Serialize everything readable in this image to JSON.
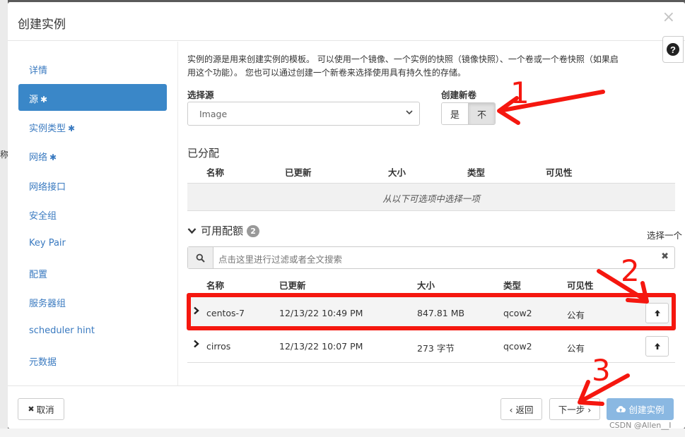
{
  "modal": {
    "title": "创建实例",
    "close_glyph": "×",
    "help_glyph": "?"
  },
  "backdrop": {
    "partial_char": "称"
  },
  "sidebar": {
    "items": [
      {
        "label": "详情",
        "required": false
      },
      {
        "label": "源",
        "required": true,
        "active": true
      },
      {
        "label": "实例类型",
        "required": true
      },
      {
        "label": "网络",
        "required": true
      },
      {
        "label": "网络接口",
        "required": false
      },
      {
        "label": "安全组",
        "required": false
      },
      {
        "label": "Key Pair",
        "required": false
      },
      {
        "label": "配置",
        "required": false
      },
      {
        "label": "服务器组",
        "required": false
      },
      {
        "label": "scheduler hint",
        "required": false
      },
      {
        "label": "元数据",
        "required": false
      }
    ],
    "required_marker": "✱"
  },
  "source": {
    "description_line1": "实例的源是用来创建实例的模板。 可以使用一个镜像、一个实例的快照（镜像快照）、一个卷或一个卷快照（如果启",
    "description_line2": "用这个功能）。 您也可以通过创建一个新卷来选择使用具有持久性的存储。",
    "select_source_label": "选择源",
    "select_source_value": "Image",
    "create_volume_label": "创建新卷",
    "create_volume_yes": "是",
    "create_volume_no": "不",
    "create_volume_selected": "不"
  },
  "allocated": {
    "title": "已分配",
    "columns": [
      "名称",
      "已更新",
      "大小",
      "类型",
      "可见性"
    ],
    "empty_text": "从以下可选项中选择一项"
  },
  "available": {
    "title": "可用配额",
    "count": "2",
    "pick_hint": "选择一个",
    "search_placeholder": "点击这里进行过滤或者全文搜索",
    "columns": [
      "名称",
      "已更新",
      "大小",
      "类型",
      "可见性"
    ],
    "rows": [
      {
        "name": "centos-7",
        "updated": "12/13/22 10:49 PM",
        "size": "847.81 MB",
        "type": "qcow2",
        "visibility": "公有"
      },
      {
        "name": "cirros",
        "updated": "12/13/22 10:07 PM",
        "size": "273 字节",
        "type": "qcow2",
        "visibility": "公有"
      }
    ]
  },
  "footer": {
    "cancel": "取消",
    "back": "‹ 返回",
    "next": "下一步 ›",
    "launch": "创建实例"
  },
  "annotations": {
    "color": "#f5170f",
    "labels": [
      "1",
      "2",
      "3"
    ]
  },
  "watermark": "CSDN @Allen__I"
}
